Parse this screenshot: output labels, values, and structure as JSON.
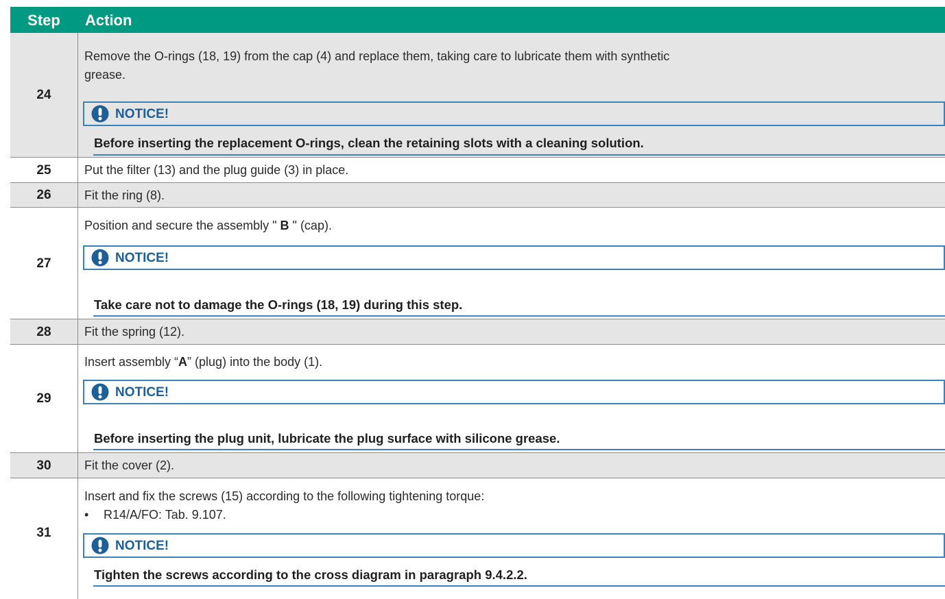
{
  "header": {
    "step": "Step",
    "action": "Action"
  },
  "notice_label": "NOTICE!",
  "rows": [
    {
      "step": "24",
      "text_a": "Remove the O-rings (18, 19) from the cap (4) and replace them, taking care to lubricate them with synthetic",
      "text_b": "grease.",
      "notice": "Before inserting the replacement O-rings, clean the retaining slots with a cleaning solution."
    },
    {
      "step": "25",
      "text": "Put the filter (13) and the plug guide (3) in place."
    },
    {
      "step": "26",
      "text": "Fit the ring (8)."
    },
    {
      "step": "27",
      "text_pre": "Position and secure the assembly \" ",
      "text_bold": "B",
      "text_post": " \" (cap).",
      "notice": "Take care not to damage the O-rings (18, 19) during this step."
    },
    {
      "step": "28",
      "text": "Fit the spring (12)."
    },
    {
      "step": "29",
      "text_pre": "Insert assembly “",
      "text_bold": "A",
      "text_post": "” (plug) into the body (1).",
      "notice": "Before inserting the plug unit, lubricate the plug surface with silicone grease."
    },
    {
      "step": "30",
      "text": "Fit the cover (2)."
    },
    {
      "step": "31",
      "text": "Insert and fix the screws (15) according to the following tightening torque:",
      "bullet": "•",
      "bullet_text": "R14/A/FO: Tab. 9.107.",
      "notice": "Tighten the screws according to the cross diagram in paragraph 9.4.2.2."
    }
  ],
  "colors": {
    "header": "#009a82",
    "notice_border": "#3a82b8",
    "notice_icon": "#1d5f99",
    "grey_row": "#e5e5e5"
  },
  "icons": {
    "notice": "exclamation-circle-icon"
  }
}
